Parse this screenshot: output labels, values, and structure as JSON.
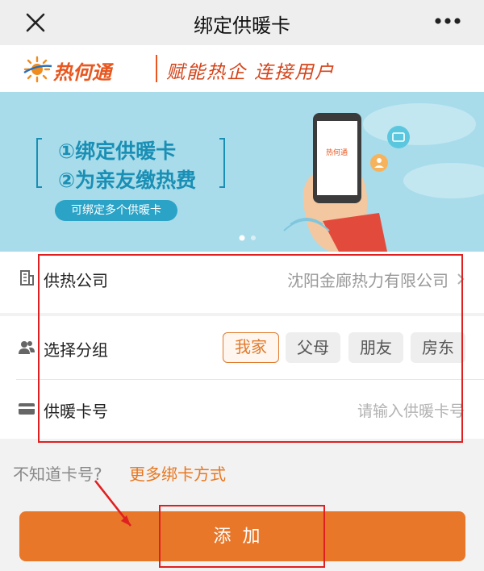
{
  "header": {
    "title": "绑定供暖卡"
  },
  "brand": {
    "name": "热何通",
    "slogan": "赋能热企 连接用户"
  },
  "banner": {
    "line1": "①绑定供暖卡",
    "line2": "②为亲友缴热费",
    "pill": "可绑定多个供暖卡"
  },
  "form": {
    "company_label": "供热公司",
    "company_value": "沈阳金廊热力有限公司",
    "group_label": "选择分组",
    "groups": [
      "我家",
      "父母",
      "朋友",
      "房东"
    ],
    "selected_group": "我家",
    "card_label": "供暖卡号",
    "card_placeholder": "请输入供暖卡号"
  },
  "hint": {
    "text": "不知道卡号?",
    "link": "更多绑卡方式"
  },
  "actions": {
    "add_label": "添加"
  },
  "colors": {
    "accent": "#e8772a",
    "banner_bg": "#a8dcea",
    "annotation": "#e02020"
  }
}
